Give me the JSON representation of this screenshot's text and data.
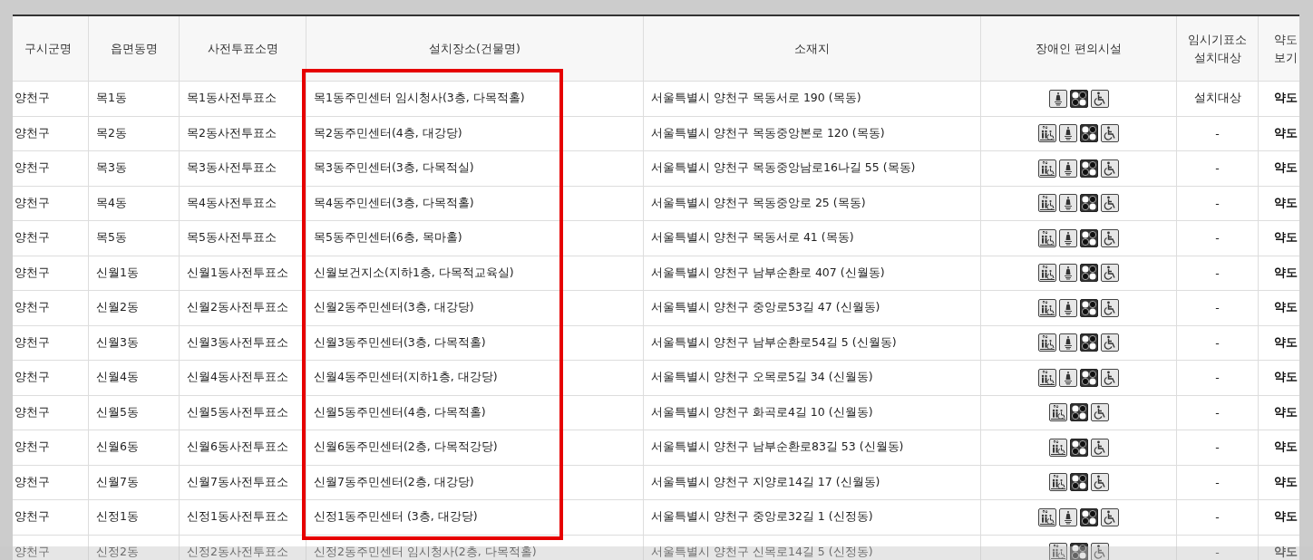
{
  "table": {
    "columns": [
      "구시군명",
      "읍면동명",
      "사전투표소명",
      "설치장소(건물명)",
      "소재지",
      "장애인 편의시설",
      "임시기표소\n설치대상",
      "약도\n보기"
    ],
    "rows": [
      {
        "cells": [
          "양천구",
          "목1동",
          "목1동사전투표소",
          "목1동주민센터 임시청사(3층, 다목적홀)",
          "서울특별시 양천구 목동서로 190 (목동)"
        ],
        "facilities": [
          {
            "kind": "bell"
          },
          {
            "kind": "braille"
          },
          {
            "kind": "wheelchair"
          }
        ],
        "temp_booth": "설치대상",
        "map": "약도"
      },
      {
        "cells": [
          "양천구",
          "목2동",
          "목2동사전투표소",
          "목2동주민센터(4층, 대강당)",
          "서울특별시 양천구 목동중앙본로 120 (목동)"
        ],
        "facilities": [
          {
            "kind": "elevator"
          },
          {
            "kind": "bell"
          },
          {
            "kind": "braille"
          },
          {
            "kind": "wheelchair"
          }
        ],
        "temp_booth": "-",
        "map": "약도"
      },
      {
        "cells": [
          "양천구",
          "목3동",
          "목3동사전투표소",
          "목3동주민센터(3층, 다목적실)",
          "서울특별시 양천구 목동중앙남로16나길 55 (목동)"
        ],
        "facilities": [
          {
            "kind": "elevator"
          },
          {
            "kind": "bell"
          },
          {
            "kind": "braille"
          },
          {
            "kind": "wheelchair"
          }
        ],
        "temp_booth": "-",
        "map": "약도"
      },
      {
        "cells": [
          "양천구",
          "목4동",
          "목4동사전투표소",
          "목4동주민센터(3층, 다목적홀)",
          "서울특별시 양천구 목동중앙로 25 (목동)"
        ],
        "facilities": [
          {
            "kind": "elevator"
          },
          {
            "kind": "bell"
          },
          {
            "kind": "braille"
          },
          {
            "kind": "wheelchair"
          }
        ],
        "temp_booth": "-",
        "map": "약도"
      },
      {
        "cells": [
          "양천구",
          "목5동",
          "목5동사전투표소",
          "목5동주민센터(6층, 목마홀)",
          "서울특별시 양천구 목동서로 41 (목동)"
        ],
        "facilities": [
          {
            "kind": "elevator"
          },
          {
            "kind": "bell"
          },
          {
            "kind": "braille"
          },
          {
            "kind": "wheelchair"
          }
        ],
        "temp_booth": "-",
        "map": "약도"
      },
      {
        "cells": [
          "양천구",
          "신월1동",
          "신월1동사전투표소",
          "신월보건지소(지하1층, 다목적교육실)",
          "서울특별시 양천구 남부순환로 407 (신월동)"
        ],
        "facilities": [
          {
            "kind": "elevator"
          },
          {
            "kind": "bell"
          },
          {
            "kind": "braille"
          },
          {
            "kind": "wheelchair"
          }
        ],
        "temp_booth": "-",
        "map": "약도"
      },
      {
        "cells": [
          "양천구",
          "신월2동",
          "신월2동사전투표소",
          "신월2동주민센터(3층, 대강당)",
          "서울특별시 양천구 중앙로53길 47 (신월동)"
        ],
        "facilities": [
          {
            "kind": "elevator"
          },
          {
            "kind": "bell"
          },
          {
            "kind": "braille"
          },
          {
            "kind": "wheelchair"
          }
        ],
        "temp_booth": "-",
        "map": "약도"
      },
      {
        "cells": [
          "양천구",
          "신월3동",
          "신월3동사전투표소",
          "신월3동주민센터(3층, 다목적홀)",
          "서울특별시 양천구 남부순환로54길 5 (신월동)"
        ],
        "facilities": [
          {
            "kind": "elevator"
          },
          {
            "kind": "bell"
          },
          {
            "kind": "braille"
          },
          {
            "kind": "wheelchair"
          }
        ],
        "temp_booth": "-",
        "map": "약도"
      },
      {
        "cells": [
          "양천구",
          "신월4동",
          "신월4동사전투표소",
          "신월4동주민센터(지하1층, 대강당)",
          "서울특별시 양천구 오목로5길 34 (신월동)"
        ],
        "facilities": [
          {
            "kind": "elevator"
          },
          {
            "kind": "bell"
          },
          {
            "kind": "braille"
          },
          {
            "kind": "wheelchair"
          }
        ],
        "temp_booth": "-",
        "map": "약도"
      },
      {
        "cells": [
          "양천구",
          "신월5동",
          "신월5동사전투표소",
          "신월5동주민센터(4층, 다목적홀)",
          "서울특별시 양천구 화곡로4길 10 (신월동)"
        ],
        "facilities": [
          {
            "kind": "elevator"
          },
          {
            "kind": "braille"
          },
          {
            "kind": "wheelchair"
          }
        ],
        "temp_booth": "-",
        "map": "약도"
      },
      {
        "cells": [
          "양천구",
          "신월6동",
          "신월6동사전투표소",
          "신월6동주민센터(2층, 다목적강당)",
          "서울특별시 양천구 남부순환로83길 53 (신월동)"
        ],
        "facilities": [
          {
            "kind": "elevator"
          },
          {
            "kind": "braille"
          },
          {
            "kind": "wheelchair"
          }
        ],
        "temp_booth": "-",
        "map": "약도"
      },
      {
        "cells": [
          "양천구",
          "신월7동",
          "신월7동사전투표소",
          "신월7동주민센터(2층, 대강당)",
          "서울특별시 양천구 지양로14길 17 (신월동)"
        ],
        "facilities": [
          {
            "kind": "elevator"
          },
          {
            "kind": "braille"
          },
          {
            "kind": "wheelchair"
          }
        ],
        "temp_booth": "-",
        "map": "약도"
      },
      {
        "cells": [
          "양천구",
          "신정1동",
          "신정1동사전투표소",
          "신정1동주민센터 (3층, 대강당)",
          "서울특별시 양천구 중앙로32길 1 (신정동)"
        ],
        "facilities": [
          {
            "kind": "elevator"
          },
          {
            "kind": "bell"
          },
          {
            "kind": "braille"
          },
          {
            "kind": "wheelchair"
          }
        ],
        "temp_booth": "-",
        "map": "약도"
      },
      {
        "cells": [
          "양천구",
          "신정2동",
          "신정2동사전투표소",
          "신정2동주민센터 임시청사(2층, 다목적홀)",
          "서울특별시 양천구 신목로14길 5 (신정동)"
        ],
        "facilities": [
          {
            "kind": "elevator"
          },
          {
            "kind": "braille"
          },
          {
            "kind": "wheelchair"
          }
        ],
        "temp_booth": "-",
        "map": "약도"
      }
    ]
  }
}
